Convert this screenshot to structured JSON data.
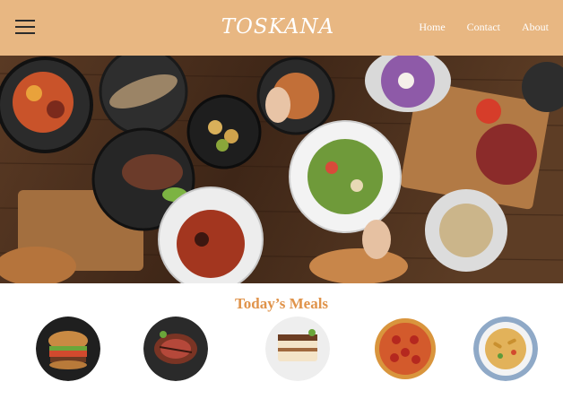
{
  "brand": {
    "logo_text": "TOSKANA"
  },
  "nav": {
    "links": [
      {
        "label": "Home"
      },
      {
        "label": "Contact"
      },
      {
        "label": "About"
      }
    ]
  },
  "icons": {
    "menu": "hamburger-menu-icon"
  },
  "colors": {
    "header_bg": "#E8B782",
    "section_title": "#E0934A",
    "nav_text": "#FFFFFF"
  },
  "meals_section": {
    "title": "Today’s Meals",
    "items": [
      {
        "image": "burger"
      },
      {
        "image": "steak"
      },
      {
        "image": "tiramisu"
      },
      {
        "image": "pizza"
      },
      {
        "image": "pasta"
      }
    ]
  }
}
